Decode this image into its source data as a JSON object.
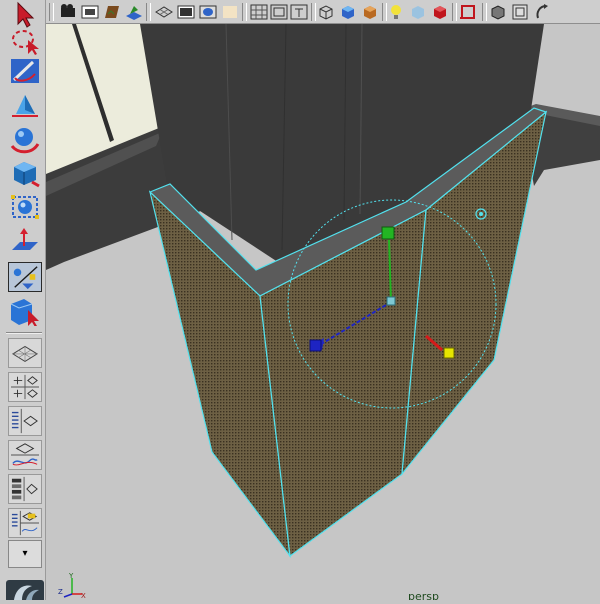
{
  "toolbox": {
    "tools": [
      {
        "name": "select-tool-icon"
      },
      {
        "name": "lasso-tool-icon"
      },
      {
        "name": "paint-select-tool-icon"
      },
      {
        "name": "move-tool-icon"
      },
      {
        "name": "rotate-tool-icon"
      },
      {
        "name": "scale-tool-icon"
      },
      {
        "name": "universal-manipulator-icon"
      },
      {
        "name": "soft-modification-icon"
      },
      {
        "name": "show-manipulator-icon",
        "selected": true
      },
      {
        "name": "last-used-tool-icon"
      }
    ],
    "layouts": [
      {
        "name": "single-perspective-layout-icon"
      },
      {
        "name": "four-view-layout-icon"
      },
      {
        "name": "outliner-perspective-layout-icon"
      },
      {
        "name": "perspective-graph-layout-icon"
      },
      {
        "name": "hypershade-perspective-layout-icon"
      },
      {
        "name": "perspective-outliner-graph-layout-icon"
      }
    ],
    "menu_dropdown_glyph": "▾"
  },
  "statusline": {
    "buttons": [
      "hide-controls-icon",
      "camera-attributes-icon",
      "camera-bookmark-icon",
      "image-plane-icon",
      "2d-pan-zoom-icon",
      "grease-pencil-icon",
      "grid-icon",
      "film-gate-icon",
      "resolution-gate-icon",
      "gate-mask-icon",
      "field-chart-icon",
      "safe-action-icon",
      "wireframe-icon",
      "smooth-shade-icon",
      "textured-icon",
      "use-all-lights-icon",
      "shadows-icon",
      "xray-icon",
      "isolate-select-icon",
      "wireframe-on-shaded-icon",
      "backface-culling-icon",
      "camera-tumble-icon"
    ]
  },
  "viewport": {
    "camera_label": "persp",
    "axis_labels": {
      "x": "X",
      "y": "Y",
      "z": "Z"
    },
    "colors": {
      "background": "#c6c6c6",
      "ground": "#bcbcbc",
      "dark_wall": "#3a3a3a",
      "selected_face": "#6f6242",
      "wire_highlight": "#52e1ee",
      "manip_x": "#d61a1a",
      "manip_y": "#23b523",
      "manip_z": "#1d24c2",
      "manip_center": "#e6e600"
    }
  }
}
